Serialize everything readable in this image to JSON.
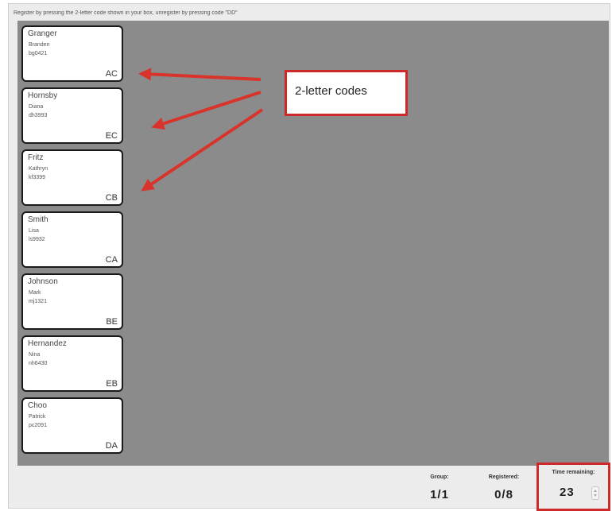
{
  "instruction": "Register by pressing the 2-letter code shown in your box, unregister by pressing code \"DD\"",
  "students": [
    {
      "last": "Granger",
      "first": "Branden",
      "id": "bg0421",
      "code": "AC"
    },
    {
      "last": "Hornsby",
      "first": "Diana",
      "id": "dh3993",
      "code": "EC"
    },
    {
      "last": "Fritz",
      "first": "Kathryn",
      "id": "kf3399",
      "code": "CB"
    },
    {
      "last": "Smith",
      "first": "Lisa",
      "id": "ls9932",
      "code": "CA"
    },
    {
      "last": "Johnson",
      "first": "Mark",
      "id": "mj1321",
      "code": "BE"
    },
    {
      "last": "Hernandez",
      "first": "Nina",
      "id": "nh6430",
      "code": "EB"
    },
    {
      "last": "Choo",
      "first": "Patrick",
      "id": "pc2091",
      "code": "DA"
    }
  ],
  "callout": {
    "text": "2-letter codes",
    "color": "#cf2a2a"
  },
  "footer": {
    "group_label": "Group:",
    "group_value": "1/1",
    "registered_label": "Registered:",
    "registered_value": "0/8",
    "time_label": "Time remaining:",
    "time_value": "23"
  }
}
